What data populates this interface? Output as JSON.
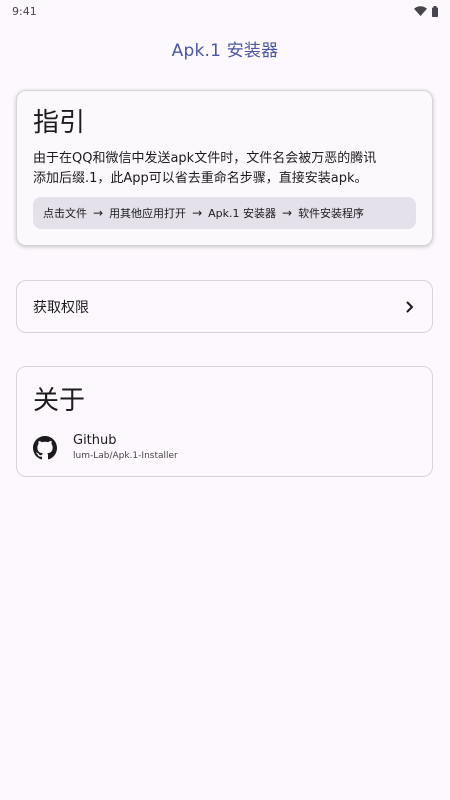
{
  "status_bar": {
    "time": "9:41"
  },
  "app_bar": {
    "title": "Apk.1 安装器"
  },
  "guide": {
    "title": "指引",
    "body_line1": "由于在QQ和微信中发送apk文件时，文件名会被万恶的腾讯",
    "body_line2": "添加后缀.1，此App可以省去重命名步骤，直接安装apk。",
    "steps": [
      "点击文件",
      "用其他应用打开",
      "Apk.1 安装器",
      "软件安装程序"
    ],
    "arrow": "→"
  },
  "permission": {
    "label": "获取权限"
  },
  "about": {
    "title": "关于",
    "github_name": "Github",
    "github_repo": "lum-Lab/Apk.1-Installer"
  },
  "colors": {
    "accent": "#4a57a3",
    "background": "#fdf8fd",
    "chip": "#e4e1ea"
  },
  "icons": [
    "wifi-icon",
    "battery-icon",
    "chevron-right-icon",
    "github-icon"
  ]
}
